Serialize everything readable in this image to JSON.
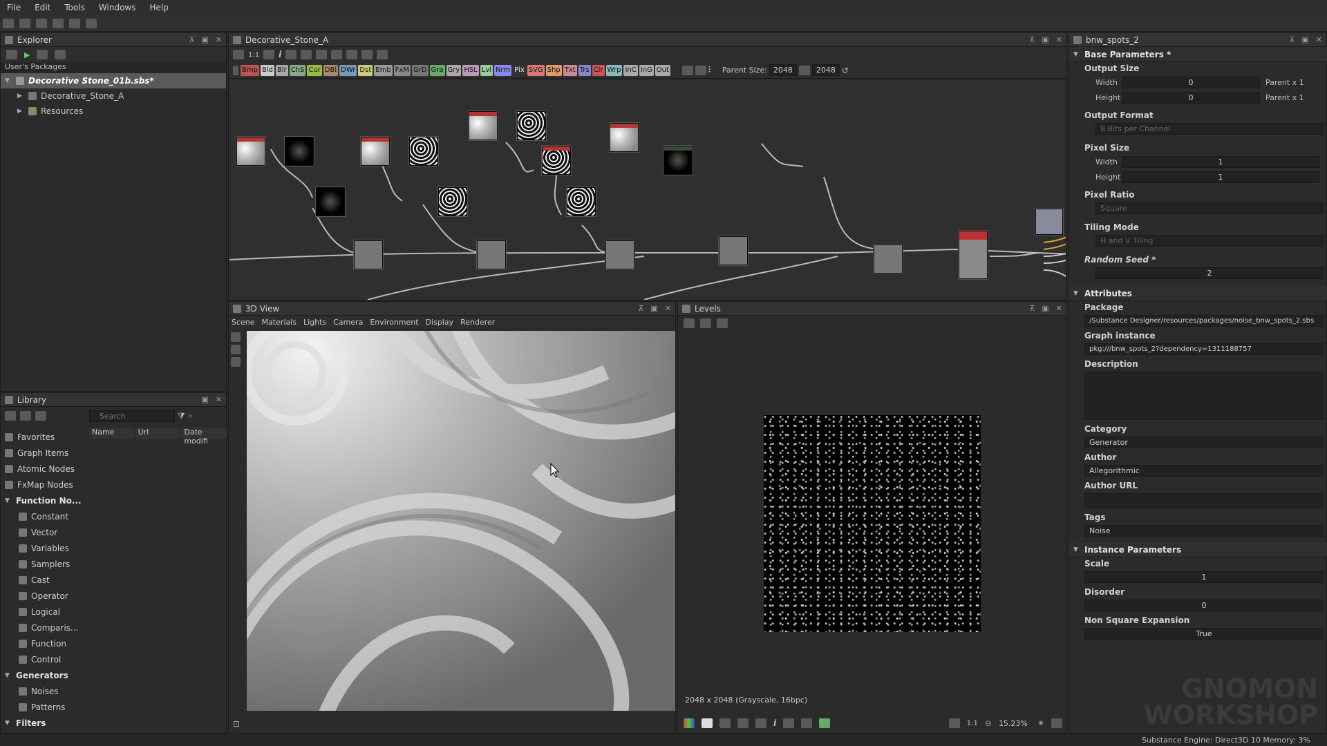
{
  "menu": [
    "File",
    "Edit",
    "Tools",
    "Windows",
    "Help"
  ],
  "explorer": {
    "title": "Explorer",
    "section": "User's Packages",
    "package": "Decorative Stone_01b.sbs*",
    "graph": "Decorative_Stone_A",
    "resources": "Resources"
  },
  "library": {
    "title": "Library",
    "search_placeholder": "Search",
    "columns": [
      "Name",
      "Url",
      "Date modifi"
    ],
    "items": [
      {
        "label": "Favorites",
        "level": "top"
      },
      {
        "label": "Graph Items",
        "level": "top"
      },
      {
        "label": "Atomic Nodes",
        "level": "top"
      },
      {
        "label": "FxMap Nodes",
        "level": "top"
      },
      {
        "label": "Function No...",
        "level": "cat"
      },
      {
        "label": "Constant",
        "level": "sub"
      },
      {
        "label": "Vector",
        "level": "sub"
      },
      {
        "label": "Variables",
        "level": "sub"
      },
      {
        "label": "Samplers",
        "level": "sub"
      },
      {
        "label": "Cast",
        "level": "sub"
      },
      {
        "label": "Operator",
        "level": "sub"
      },
      {
        "label": "Logical",
        "level": "sub"
      },
      {
        "label": "Comparis...",
        "level": "sub"
      },
      {
        "label": "Function",
        "level": "sub"
      },
      {
        "label": "Control",
        "level": "sub"
      },
      {
        "label": "Generators",
        "level": "cat"
      },
      {
        "label": "Noises",
        "level": "sub"
      },
      {
        "label": "Patterns",
        "level": "sub"
      },
      {
        "label": "Filters",
        "level": "cat"
      }
    ]
  },
  "graph": {
    "title": "Decorative_Stone_A",
    "ratio": "1:1",
    "chips": [
      {
        "t": "Bmp",
        "c": "#b55"
      },
      {
        "t": "Bld",
        "c": "#ccc"
      },
      {
        "t": "Blr",
        "c": "#aaa"
      },
      {
        "t": "ChS",
        "c": "#8a8"
      },
      {
        "t": "Cur",
        "c": "#9b4"
      },
      {
        "t": "DBl",
        "c": "#a86"
      },
      {
        "t": "DWr",
        "c": "#79b"
      },
      {
        "t": "Dst",
        "c": "#cc7"
      },
      {
        "t": "Emb",
        "c": "#999"
      },
      {
        "t": "FxM",
        "c": "#888"
      },
      {
        "t": "GrD",
        "c": "#777"
      },
      {
        "t": "Gra",
        "c": "#6a6"
      },
      {
        "t": "Gry",
        "c": "#aaa"
      },
      {
        "t": "HSL",
        "c": "#b9b"
      },
      {
        "t": "Lvl",
        "c": "#9c9"
      },
      {
        "t": "Nrm",
        "c": "#88e"
      },
      {
        "t": "Pix",
        "c": "#333"
      },
      {
        "t": "SVG",
        "c": "#d77"
      },
      {
        "t": "Shp",
        "c": "#d96"
      },
      {
        "t": "Txt",
        "c": "#c89"
      },
      {
        "t": "Trs",
        "c": "#88c"
      },
      {
        "t": "Clr",
        "c": "#c55"
      },
      {
        "t": "Wrp",
        "c": "#8bb"
      },
      {
        "t": "InC",
        "c": "#aaa"
      },
      {
        "t": "InG",
        "c": "#aaa"
      },
      {
        "t": "Out",
        "c": "#aaa"
      }
    ],
    "parent_size_label": "Parent Size:",
    "parent_size": "2048",
    "size2": "2048"
  },
  "view3d": {
    "title": "3D View",
    "menu": [
      "Scene",
      "Materials",
      "Lights",
      "Camera",
      "Environment",
      "Display",
      "Renderer"
    ]
  },
  "levels": {
    "title": "Levels",
    "info": "2048 x 2048 (Grayscale, 16bpc)",
    "ratio": "1:1",
    "zoom": "15.23%"
  },
  "props": {
    "title": "bnw_spots_2",
    "base": "Base Parameters *",
    "output_size": "Output Size",
    "width": "Width",
    "height": "Height",
    "zero": "0",
    "parent_x1": "Parent x 1",
    "output_format": "Output Format",
    "output_format_val": "8 Bits per Channel",
    "pixel_size": "Pixel Size",
    "one": "1",
    "pixel_ratio": "Pixel Ratio",
    "pixel_ratio_val": "Square",
    "tiling": "Tiling Mode",
    "tiling_val": "H and V Tiling",
    "seed": "Random Seed *",
    "seed_val": "2",
    "attributes": "Attributes",
    "package": "Package",
    "package_val": "/Substance Designer/resources/packages/noise_bnw_spots_2.sbs",
    "graph_instance": "Graph instance",
    "graph_instance_val": "pkg:///bnw_spots_2?dependency=1311188757",
    "description": "Description",
    "category": "Category",
    "category_val": "Generator",
    "author": "Author",
    "author_val": "Allegorithmic",
    "author_url": "Author URL",
    "tags": "Tags",
    "tags_val": "Noise",
    "instance": "Instance Parameters",
    "scale": "Scale",
    "scale_val": "1",
    "disorder": "Disorder",
    "disorder_val": "0",
    "nse": "Non Square Expansion",
    "nse_val": "True"
  },
  "watermark": "GNOMON WORKSHOP",
  "status": "Substance Engine: Direct3D 10  Memory: 3%"
}
